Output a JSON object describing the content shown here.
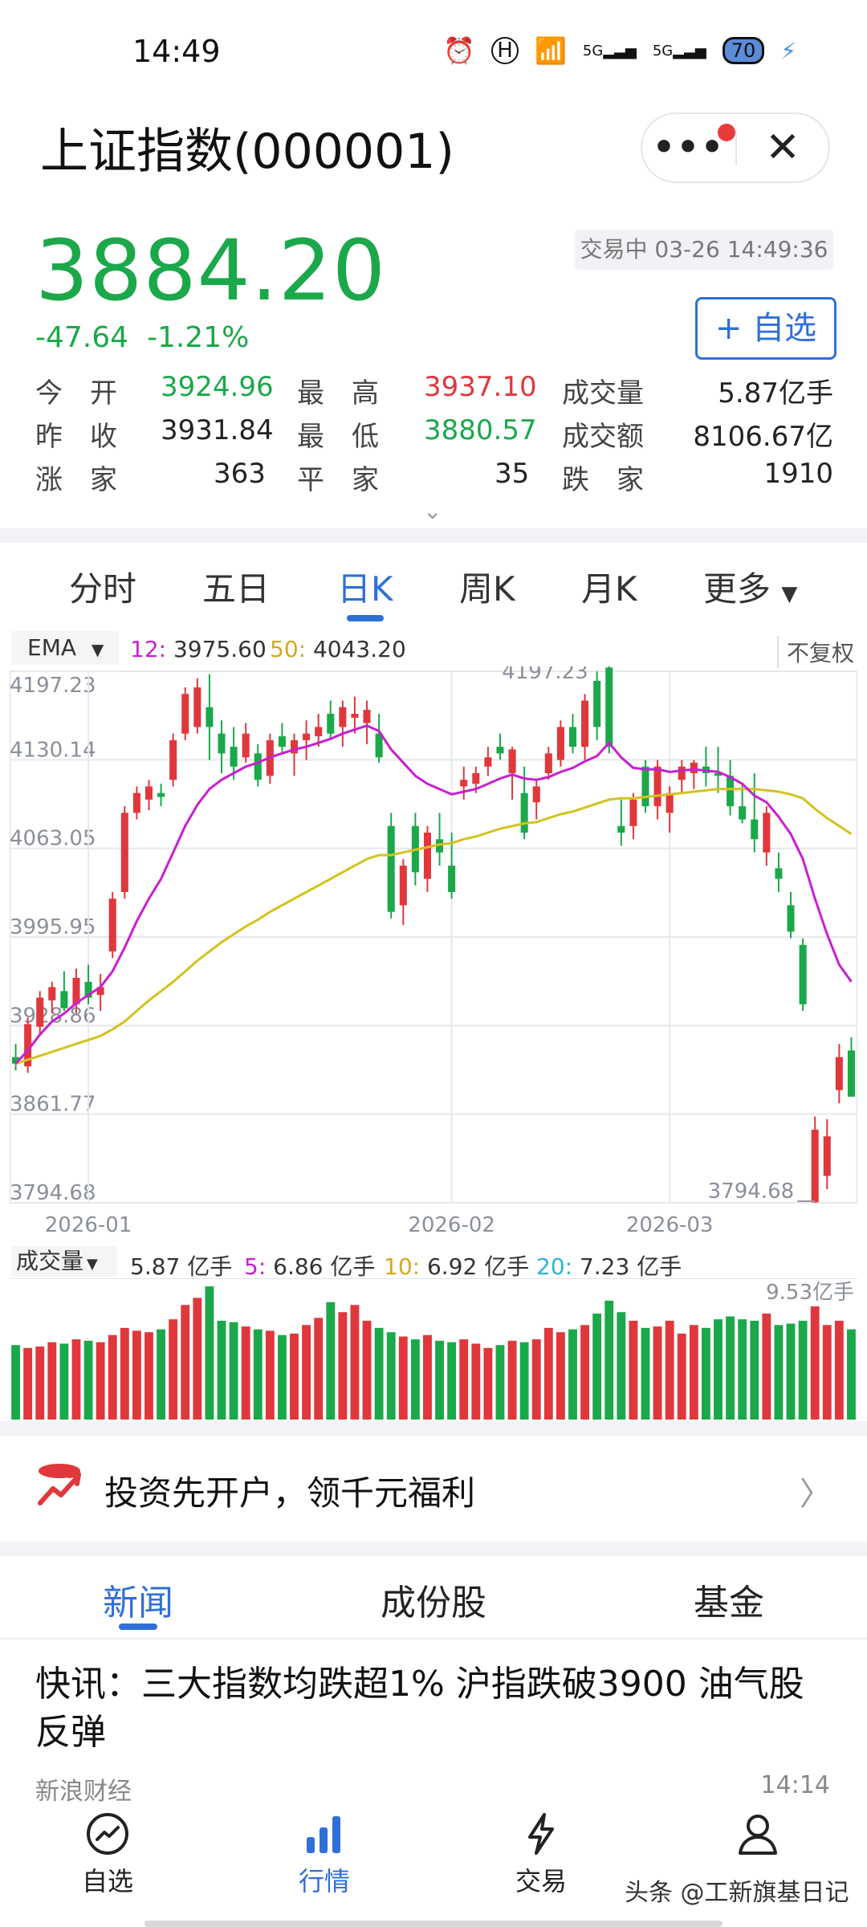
{
  "status_bar": {
    "time": "14:49",
    "network1": "5G",
    "network2": "5G",
    "battery": "70"
  },
  "header": {
    "title": "上证指数(000001)",
    "more_label": "•••",
    "close_label": "✕"
  },
  "quote": {
    "price": "3884.20",
    "change": "-47.64",
    "change_pct": "-1.21%",
    "trade_status": "交易中 03-26 14:49:36",
    "watch_button": "+ 自选",
    "stats": {
      "open_label": "今　开",
      "open": "3924.96",
      "high_label": "最　高",
      "high": "3937.10",
      "volume_label": "成交量",
      "volume": "5.87亿手",
      "prev_close_label": "昨　收",
      "prev_close": "3931.84",
      "low_label": "最　低",
      "low": "3880.57",
      "amount_label": "成交额",
      "amount": "8106.67亿",
      "up_label": "涨　家",
      "up": "363",
      "flat_label": "平　家",
      "flat": "35",
      "down_label": "跌　家",
      "down": "1910"
    }
  },
  "tabs": [
    "分时",
    "五日",
    "日K",
    "周K",
    "月K",
    "更多"
  ],
  "active_tab": "日K",
  "colors": {
    "up": "#e0373c",
    "down": "#1ba84a",
    "accent": "#2f6fd8",
    "ema12": "#c81fd1",
    "ema50": "#d4c21e",
    "ma20": "#2bb6d1"
  },
  "chart_data": {
    "type": "candlestick",
    "indicator_label": "EMA",
    "ema12_label": "12:",
    "ema12_value": "3975.60",
    "ema50_label": "50:",
    "ema50_value": "4043.20",
    "adjust_label": "不复权",
    "y_ticks": [
      "4197.23",
      "4130.14",
      "4063.05",
      "3995.95",
      "3928.86",
      "3861.77",
      "3794.68"
    ],
    "ylim": [
      3794.68,
      4197.23
    ],
    "x_ticks": [
      "2026-01",
      "2026-02",
      "2026-03"
    ],
    "max_label": "4197.23",
    "min_label": "3794.68",
    "candles": [
      [
        3905,
        3915,
        3895,
        3900
      ],
      [
        3898,
        3935,
        3893,
        3930
      ],
      [
        3928,
        3955,
        3922,
        3950
      ],
      [
        3948,
        3962,
        3938,
        3958
      ],
      [
        3955,
        3970,
        3940,
        3942
      ],
      [
        3945,
        3972,
        3938,
        3965
      ],
      [
        3962,
        3975,
        3945,
        3950
      ],
      [
        3952,
        3968,
        3940,
        3958
      ],
      [
        3985,
        4030,
        3980,
        4025
      ],
      [
        4030,
        4095,
        4025,
        4090
      ],
      [
        4090,
        4110,
        4085,
        4105
      ],
      [
        4100,
        4115,
        4092,
        4110
      ],
      [
        4105,
        4112,
        4095,
        4102
      ],
      [
        4115,
        4150,
        4110,
        4145
      ],
      [
        4150,
        4185,
        4145,
        4180
      ],
      [
        4155,
        4192,
        4150,
        4185
      ],
      [
        4170,
        4195,
        4130,
        4155
      ],
      [
        4150,
        4160,
        4120,
        4135
      ],
      [
        4140,
        4155,
        4115,
        4125
      ],
      [
        4132,
        4158,
        4128,
        4150
      ],
      [
        4135,
        4142,
        4110,
        4115
      ],
      [
        4118,
        4150,
        4112,
        4145
      ],
      [
        4148,
        4158,
        4135,
        4140
      ],
      [
        4135,
        4150,
        4118,
        4145
      ],
      [
        4145,
        4160,
        4130,
        4150
      ],
      [
        4148,
        4165,
        4140,
        4155
      ],
      [
        4165,
        4175,
        4145,
        4150
      ],
      [
        4155,
        4175,
        4140,
        4170
      ],
      [
        4162,
        4178,
        4150,
        4165
      ],
      [
        4158,
        4175,
        4142,
        4168
      ],
      [
        4150,
        4165,
        4128,
        4132
      ],
      [
        4080,
        4090,
        4010,
        4015
      ],
      [
        4020,
        4055,
        4005,
        4050
      ],
      [
        4080,
        4090,
        4035,
        4045
      ],
      [
        4040,
        4080,
        4030,
        4075
      ],
      [
        4070,
        4090,
        4050,
        4060
      ],
      [
        4050,
        4075,
        4025,
        4030
      ],
      [
        4110,
        4125,
        4100,
        4115
      ],
      [
        4112,
        4125,
        4105,
        4120
      ],
      [
        4125,
        4140,
        4118,
        4132
      ],
      [
        4140,
        4150,
        4130,
        4135
      ],
      [
        4120,
        4140,
        4100,
        4138
      ],
      [
        4105,
        4125,
        4070,
        4075
      ],
      [
        4098,
        4115,
        4085,
        4110
      ],
      [
        4120,
        4140,
        4115,
        4135
      ],
      [
        4130,
        4160,
        4125,
        4155
      ],
      [
        4155,
        4165,
        4135,
        4140
      ],
      [
        4140,
        4180,
        4130,
        4175
      ],
      [
        4190,
        4197,
        4145,
        4155
      ],
      [
        4200,
        4205,
        4135,
        4140
      ],
      [
        4080,
        4100,
        4065,
        4075
      ],
      [
        4080,
        4105,
        4070,
        4100
      ],
      [
        4125,
        4130,
        4090,
        4095
      ],
      [
        4095,
        4130,
        4085,
        4125
      ],
      [
        4090,
        4110,
        4075,
        4105
      ],
      [
        4115,
        4130,
        4105,
        4125
      ],
      [
        4120,
        4130,
        4108,
        4128
      ],
      [
        4125,
        4140,
        4110,
        4120
      ],
      [
        4120,
        4140,
        4105,
        4118
      ],
      [
        4118,
        4130,
        4088,
        4095
      ],
      [
        4095,
        4112,
        4082,
        4085
      ],
      [
        4085,
        4120,
        4060,
        4070
      ],
      [
        4060,
        4095,
        4050,
        4090
      ],
      [
        4048,
        4060,
        4030,
        4040
      ],
      [
        4020,
        4030,
        3995,
        4000
      ],
      [
        3990,
        3995,
        3940,
        3945
      ],
      [
        3795,
        3860,
        3794.68,
        3850
      ],
      [
        3815,
        3858,
        3805,
        3845
      ],
      [
        3880,
        3915,
        3870,
        3905
      ],
      [
        3910,
        3920,
        3880,
        3875
      ]
    ],
    "ema12": [
      3900,
      3910,
      3922,
      3932,
      3938,
      3946,
      3952,
      3958,
      3970,
      3988,
      4008,
      4025,
      4040,
      4060,
      4080,
      4096,
      4108,
      4115,
      4120,
      4125,
      4128,
      4132,
      4135,
      4138,
      4140,
      4143,
      4146,
      4150,
      4153,
      4156,
      4152,
      4138,
      4128,
      4118,
      4112,
      4108,
      4104,
      4106,
      4108,
      4112,
      4116,
      4119,
      4116,
      4115,
      4117,
      4121,
      4124,
      4129,
      4133,
      4143,
      4132,
      4124,
      4123,
      4123,
      4121,
      4122,
      4123,
      4122,
      4121,
      4117,
      4112,
      4103,
      4098,
      4087,
      4074,
      4055,
      4025,
      3998,
      3975,
      3962
    ],
    "ema50": [
      3900,
      3903,
      3906,
      3909,
      3912,
      3915,
      3918,
      3921,
      3926,
      3932,
      3940,
      3948,
      3955,
      3962,
      3970,
      3978,
      3985,
      3992,
      3998,
      4004,
      4009,
      4015,
      4020,
      4025,
      4030,
      4035,
      4040,
      4045,
      4050,
      4055,
      4058,
      4058,
      4060,
      4062,
      4064,
      4066,
      4067,
      4070,
      4072,
      4075,
      4078,
      4080,
      4082,
      4083,
      4086,
      4089,
      4091,
      4094,
      4097,
      4100,
      4101,
      4101,
      4102,
      4103,
      4104,
      4105,
      4106,
      4107,
      4108,
      4108,
      4108,
      4108,
      4107,
      4106,
      4104,
      4101,
      4093,
      4086,
      4080,
      4074
    ]
  },
  "volume": {
    "label": "成交量",
    "current": "5.87 亿手",
    "ma5_label": "5:",
    "ma5": "6.86 亿手",
    "ma10_label": "10:",
    "ma10": "6.92 亿手",
    "ma20_label": "20:",
    "ma20": "7.23 亿手",
    "max_label": "9.53亿手",
    "bars": [
      5.2,
      5.0,
      5.1,
      5.4,
      5.3,
      5.6,
      5.5,
      5.4,
      5.9,
      6.4,
      6.2,
      6.1,
      6.3,
      7.0,
      8.0,
      8.5,
      9.3,
      6.9,
      6.8,
      6.5,
      6.3,
      6.2,
      5.9,
      6.0,
      6.6,
      7.1,
      8.2,
      7.5,
      8.0,
      6.9,
      6.4,
      6.1,
      5.8,
      5.6,
      5.9,
      5.5,
      5.4,
      5.6,
      5.3,
      5.0,
      5.2,
      5.5,
      5.4,
      5.6,
      6.4,
      6.1,
      6.3,
      6.6,
      7.4,
      8.3,
      7.5,
      6.9,
      6.4,
      6.5,
      6.9,
      6.0,
      6.6,
      6.4,
      7.0,
      7.2,
      7.0,
      6.9,
      7.4,
      6.6,
      6.7,
      6.9,
      7.9,
      6.6,
      6.9,
      6.3
    ]
  },
  "banner": {
    "text": "投资先开户，领千元福利",
    "arrow": "〉"
  },
  "news_tabs": [
    "新闻",
    "成份股",
    "基金"
  ],
  "news": {
    "headline": "快讯：三大指数均跌超1% 沪指跌破3900 油气股反弹",
    "source": "新浪财经",
    "time": "14:14"
  },
  "bottom_nav": {
    "items": [
      "自选",
      "行情",
      "交易",
      "我的"
    ],
    "active": "行情"
  },
  "watermark": "头条 @工新旗基日记"
}
